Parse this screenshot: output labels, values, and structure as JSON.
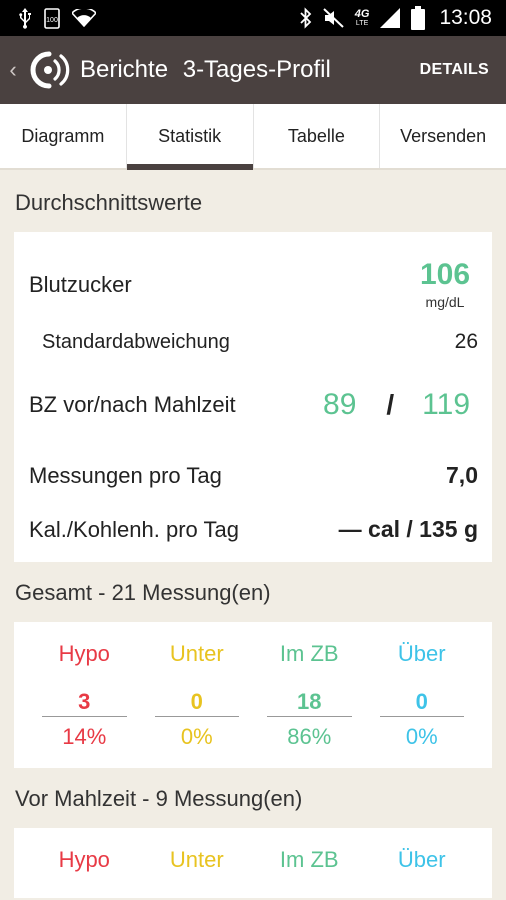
{
  "status_bar": {
    "time": "13:08",
    "battery_text": "100",
    "network": "4G",
    "network_sub": "LTE",
    "icons": [
      "usb-icon",
      "battery-level-icon",
      "wifi-icon",
      "bluetooth-icon",
      "mute-icon",
      "signal-icon",
      "battery-icon"
    ]
  },
  "action_bar": {
    "section": "Berichte",
    "subtitle": "3-Tages-Profil",
    "details_label": "DETAILS",
    "bg_color": "#4a4140"
  },
  "tabs": [
    {
      "label": "Diagramm",
      "active": false
    },
    {
      "label": "Statistik",
      "active": true
    },
    {
      "label": "Tabelle",
      "active": false
    },
    {
      "label": "Versenden",
      "active": false
    }
  ],
  "averages": {
    "title": "Durchschnittswerte",
    "blood_sugar": {
      "label": "Blutzucker",
      "value": "106",
      "unit": "mg/dL"
    },
    "std_dev": {
      "label": "Standardabweichung",
      "value": "26"
    },
    "pre_post": {
      "label": "BZ vor/nach Mahlzeit",
      "pre": "89",
      "separator": "/",
      "post": "119"
    },
    "measurements_per_day": {
      "label": "Messungen pro Tag",
      "value": "7,0"
    },
    "cal_carbs_per_day": {
      "label": "Kal./Kohlenh. pro Tag",
      "value": "— cal / 135 g"
    }
  },
  "total": {
    "title": "Gesamt - 21 Messung(en)",
    "columns": [
      {
        "label": "Hypo",
        "count": "3",
        "percent": "14%",
        "color": "#e83a45"
      },
      {
        "label": "Unter",
        "count": "0",
        "percent": "0%",
        "color": "#e8c320"
      },
      {
        "label": "Im ZB",
        "count": "18",
        "percent": "86%",
        "color": "#5cc391"
      },
      {
        "label": "Über",
        "count": "0",
        "percent": "0%",
        "color": "#3ec3e8"
      }
    ]
  },
  "before_meal": {
    "title": "Vor Mahlzeit - 9 Messung(en)",
    "columns": [
      {
        "label": "Hypo"
      },
      {
        "label": "Unter"
      },
      {
        "label": "Im ZB"
      },
      {
        "label": "Über"
      }
    ]
  }
}
